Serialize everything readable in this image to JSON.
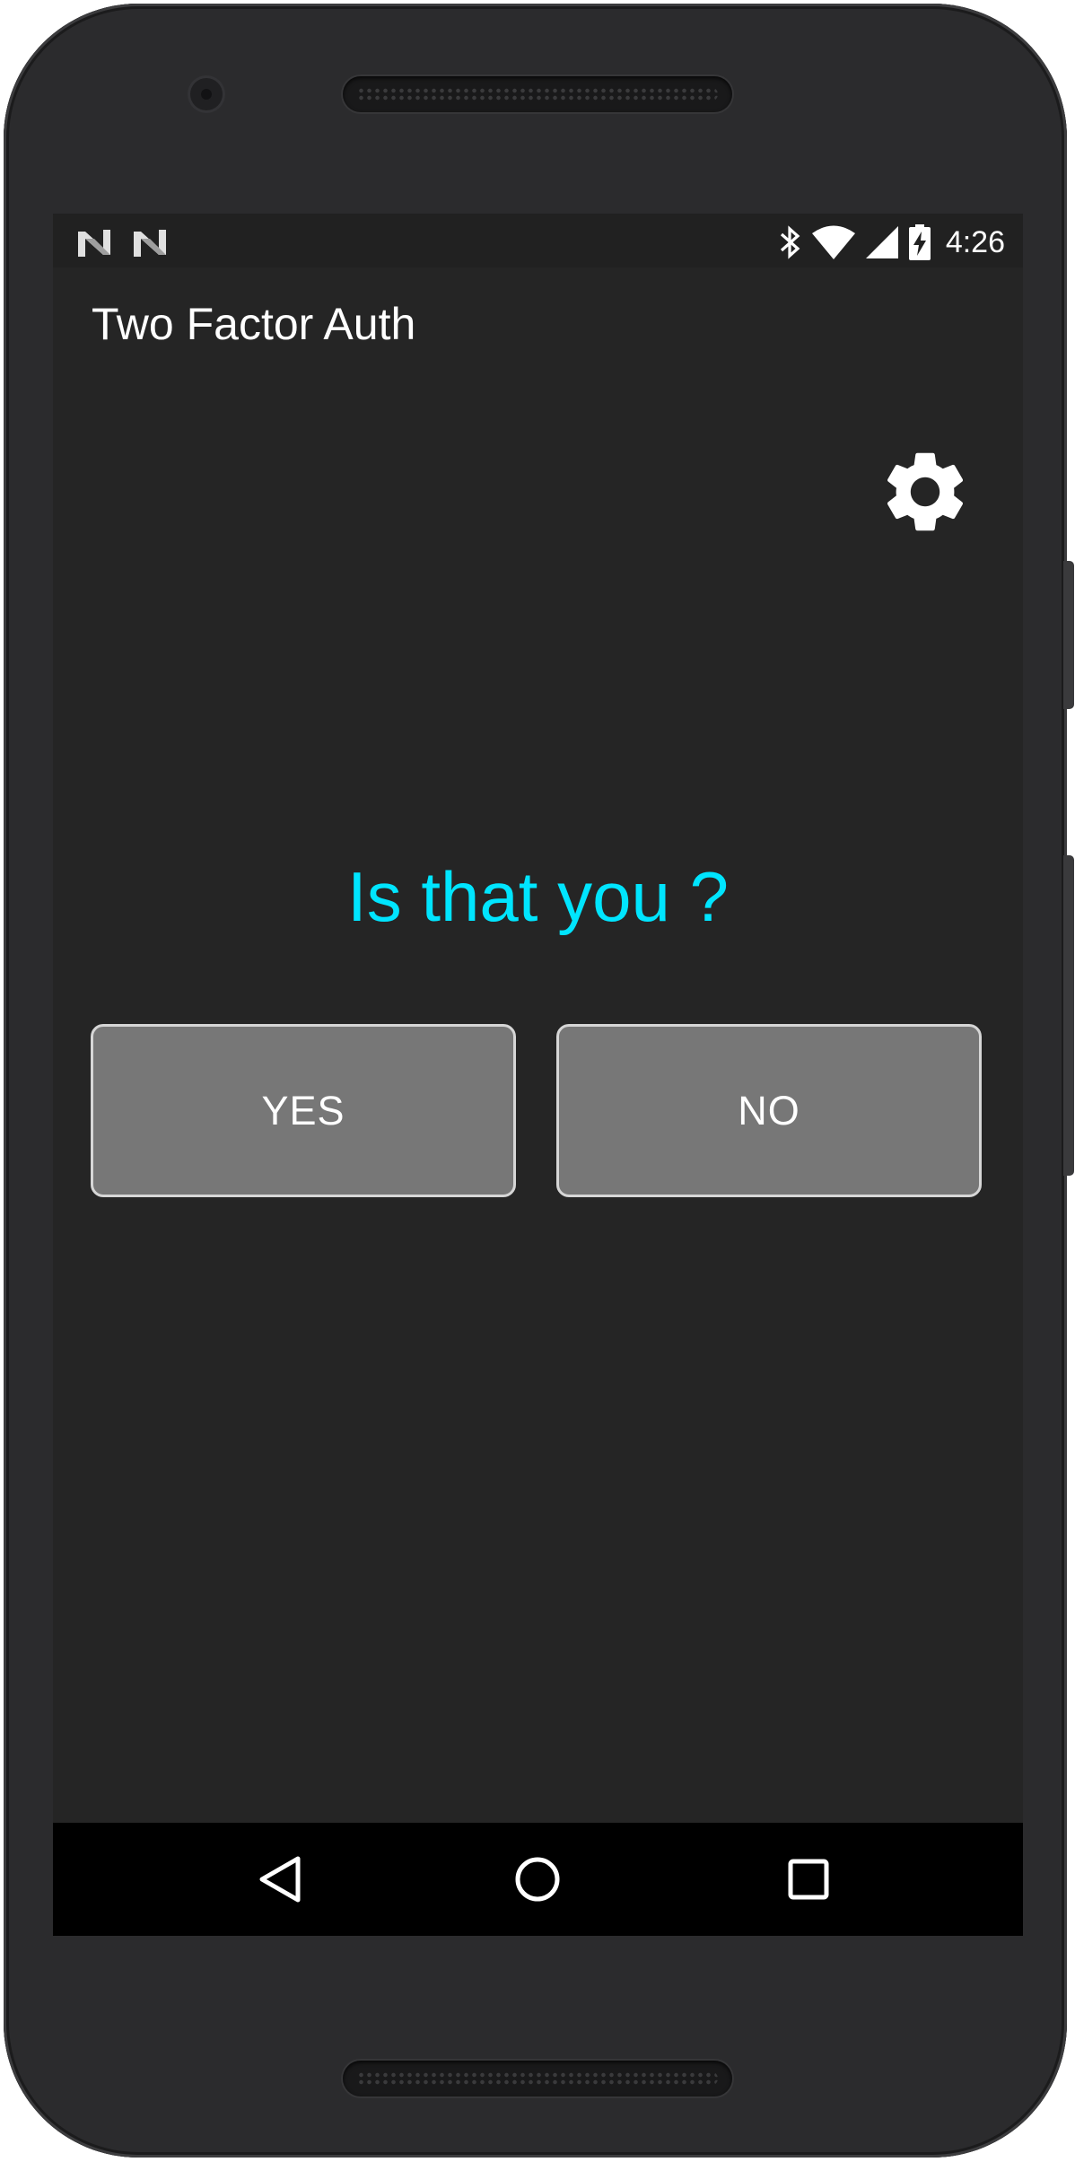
{
  "status_bar": {
    "time": "4:26",
    "left_icons": [
      "notification-n-icon",
      "notification-n-icon"
    ],
    "right_icons": [
      "bluetooth-icon",
      "wifi-icon",
      "cell-signal-icon",
      "battery-charging-icon"
    ]
  },
  "app_bar": {
    "title": "Two Factor Auth"
  },
  "settings": {
    "icon": "gear-icon"
  },
  "main": {
    "question": "Is that you ?",
    "yes_label": "YES",
    "no_label": "NO"
  },
  "nav_bar": {
    "icons": [
      "back-icon",
      "home-icon",
      "recents-icon"
    ]
  },
  "colors": {
    "background": "#252525",
    "accent": "#00e5ff",
    "button": "#777777",
    "button_border": "#d6d6d6",
    "nav_bar": "#000000"
  }
}
